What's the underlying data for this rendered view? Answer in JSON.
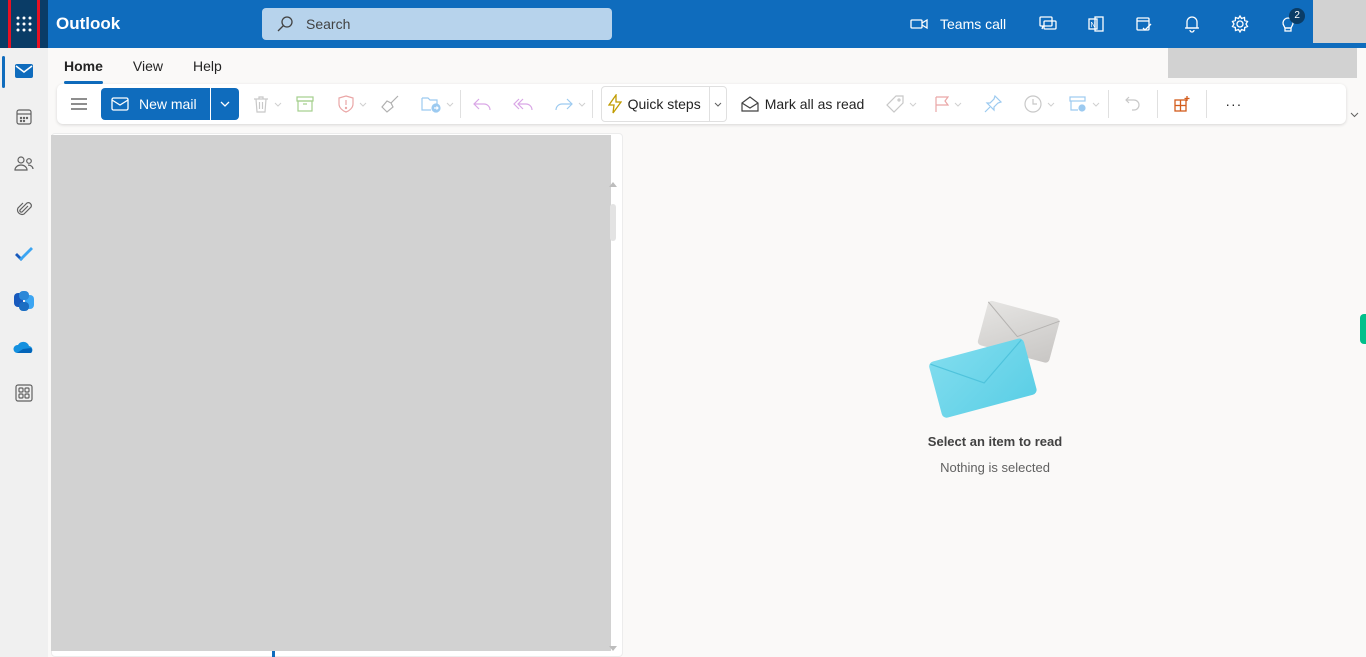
{
  "app": {
    "title": "Outlook"
  },
  "search": {
    "placeholder": "Search",
    "value": ""
  },
  "topbar": {
    "teams_call_label": "Teams call",
    "icons": [
      "video-icon",
      "chat-icon",
      "onenote-icon",
      "todo-calendar-icon",
      "bell-icon",
      "gear-icon",
      "lightbulb-icon"
    ],
    "tips_badge_count": "2"
  },
  "rail": {
    "items": [
      {
        "name": "mail",
        "active": true
      },
      {
        "name": "calendar"
      },
      {
        "name": "people"
      },
      {
        "name": "files"
      },
      {
        "name": "todo"
      },
      {
        "name": "copilot"
      },
      {
        "name": "onedrive"
      },
      {
        "name": "more-apps"
      }
    ]
  },
  "tabs": [
    {
      "label": "Home",
      "active": true
    },
    {
      "label": "View"
    },
    {
      "label": "Help"
    }
  ],
  "ribbon": {
    "new_mail_label": "New mail",
    "quick_steps_label": "Quick steps",
    "mark_all_read_label": "Mark all as read",
    "more_label": "···"
  },
  "reading_pane": {
    "empty_title": "Select an item to read",
    "empty_subtitle": "Nothing is selected"
  },
  "colors": {
    "brand": "#0f6cbd",
    "waffle_bg": "#0a3c66",
    "highlight": "#e81123",
    "redacted": "#d2d2d2"
  }
}
